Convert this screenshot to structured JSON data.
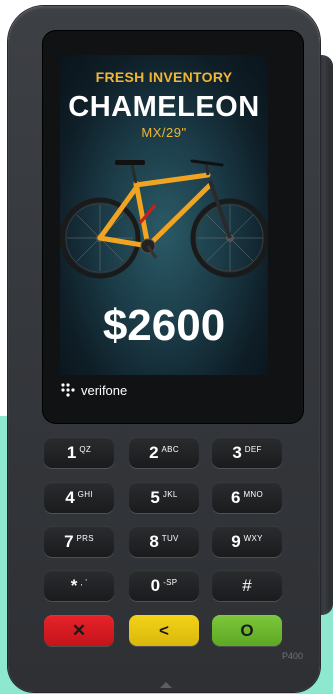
{
  "screen": {
    "headline": "FRESH INVENTORY",
    "model": "CHAMELEON",
    "size": "MX/29\"",
    "price": "$2600"
  },
  "brand": {
    "name": "verifone"
  },
  "device": {
    "model_label": "P400"
  },
  "keypad": {
    "keys": [
      {
        "num": "1",
        "letters": "QZ"
      },
      {
        "num": "2",
        "letters": "ABC"
      },
      {
        "num": "3",
        "letters": "DEF"
      },
      {
        "num": "4",
        "letters": "GHI"
      },
      {
        "num": "5",
        "letters": "JKL"
      },
      {
        "num": "6",
        "letters": "MNO"
      },
      {
        "num": "7",
        "letters": "PRS"
      },
      {
        "num": "8",
        "letters": "TUV"
      },
      {
        "num": "9",
        "letters": "WXY"
      },
      {
        "num": "*",
        "letters": ", '"
      },
      {
        "num": "0",
        "letters": "-SP"
      },
      {
        "num": "#",
        "letters": ""
      }
    ],
    "function_keys": [
      {
        "symbol": "✕",
        "color": "#e8222a"
      },
      {
        "symbol": "<",
        "color": "#f4d218"
      },
      {
        "symbol": "O",
        "color": "#7cc63a"
      }
    ]
  },
  "colors": {
    "accent": "#f2b634",
    "device": "#34373b",
    "background": "#8ee8cf"
  }
}
